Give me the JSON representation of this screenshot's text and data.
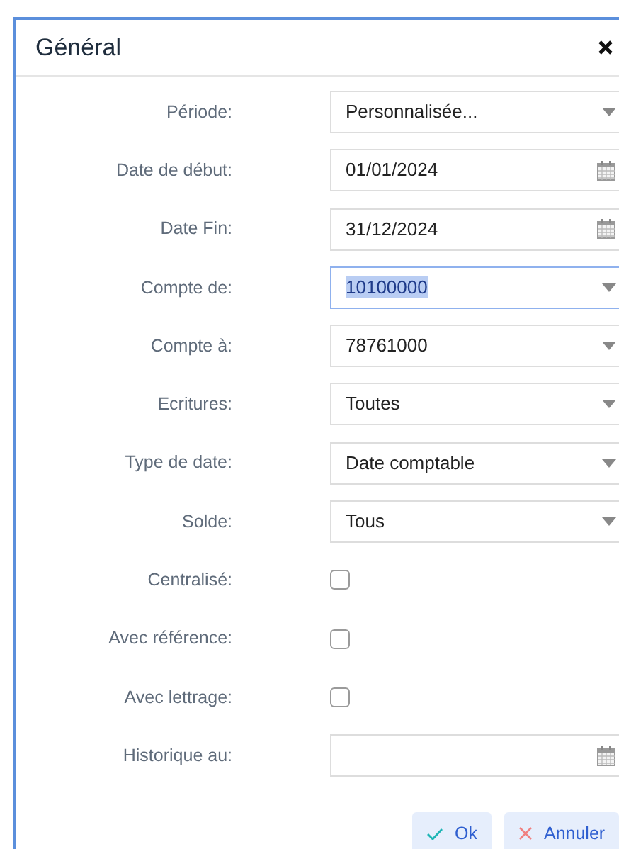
{
  "dialog": {
    "title": "Général"
  },
  "fields": [
    {
      "label": "Période:",
      "kind": "select",
      "value": "Personnalisée...",
      "focused": false
    },
    {
      "label": "Date de début:",
      "kind": "date",
      "value": "01/01/2024",
      "focused": false
    },
    {
      "label": "Date Fin:",
      "kind": "date",
      "value": "31/12/2024",
      "focused": false
    },
    {
      "label": "Compte de:",
      "kind": "select",
      "value": "10100000",
      "focused": true
    },
    {
      "label": "Compte à:",
      "kind": "select",
      "value": "78761000",
      "focused": false
    },
    {
      "label": "Ecritures:",
      "kind": "select",
      "value": "Toutes",
      "focused": false
    },
    {
      "label": "Type de date:",
      "kind": "select",
      "value": "Date comptable",
      "focused": false
    },
    {
      "label": "Solde:",
      "kind": "select",
      "value": "Tous",
      "focused": false
    },
    {
      "label": "Centralisé:",
      "kind": "checkbox",
      "checked": false
    },
    {
      "label": "Avec référence:",
      "kind": "checkbox",
      "checked": false
    },
    {
      "label": "Avec lettrage:",
      "kind": "checkbox",
      "checked": false
    },
    {
      "label": "Historique au:",
      "kind": "date",
      "focused": false
    }
  ],
  "buttons": [
    {
      "label": "Ok",
      "kind": "ok"
    },
    {
      "label": "Annuler",
      "kind": "cancel"
    }
  ]
}
